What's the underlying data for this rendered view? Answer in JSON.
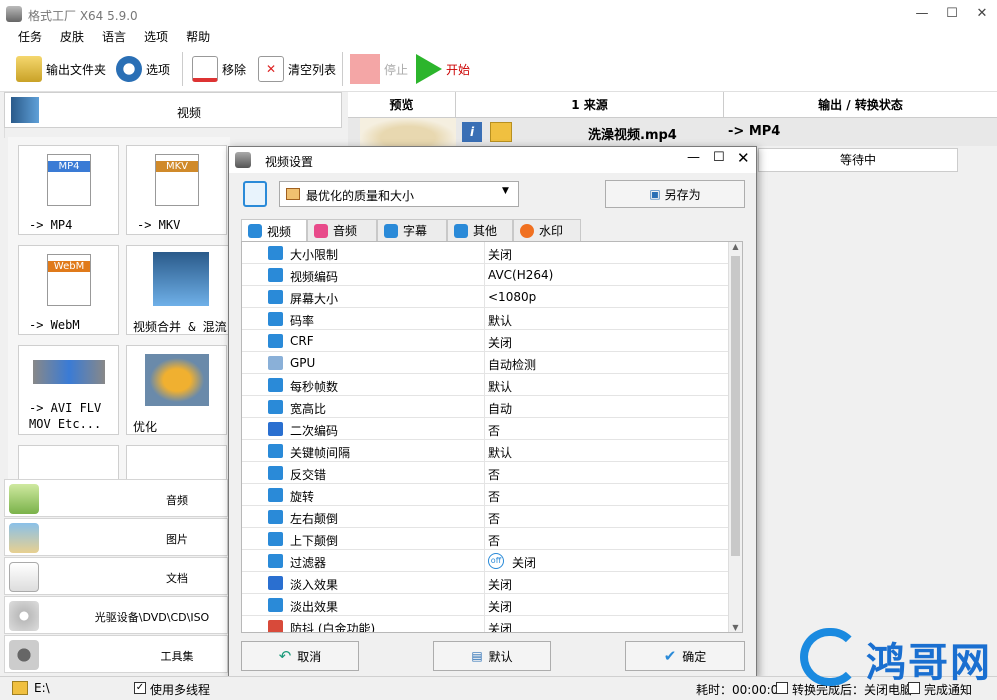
{
  "app": {
    "title": "格式工厂 X64 5.9.0"
  },
  "menu": [
    "任务",
    "皮肤",
    "语言",
    "选项",
    "帮助"
  ],
  "toolbar": {
    "output_folder": "输出文件夹",
    "options": "选项",
    "remove": "移除",
    "clear_list": "清空列表",
    "stop": "停止",
    "start": "开始"
  },
  "left": {
    "video_header": "视频",
    "tiles": [
      {
        "label": "-> MP4",
        "badge": "MP4"
      },
      {
        "label": "-> MKV",
        "badge": "MKV"
      },
      {
        "label": "-> WebM",
        "badge": "WebM"
      },
      {
        "label": "视频合并 & 混流"
      },
      {
        "label": "-> AVI FLV\nMOV Etc..."
      },
      {
        "label": "优化"
      }
    ],
    "categories": [
      "音频",
      "图片",
      "文档",
      "光驱设备\\DVD\\CD\\ISO",
      "工具集"
    ]
  },
  "grid": {
    "headers": [
      "预览",
      "1 来源",
      "输出 / 转换状态"
    ],
    "file_name": "洗澡视频.mp4",
    "output": "-> MP4",
    "status": "等待中"
  },
  "dialog": {
    "title": "视频设置",
    "preset": "最优化的质量和大小",
    "save_as": "另存为",
    "tabs": [
      "视频",
      "音频",
      "字幕",
      "其他",
      "水印"
    ],
    "params": [
      {
        "name": "大小限制",
        "value": "关闭",
        "icon": "size-limit"
      },
      {
        "name": "视频编码",
        "value": "AVC(H264)",
        "icon": "codec"
      },
      {
        "name": "屏幕大小",
        "value": "<1080p",
        "icon": "screen"
      },
      {
        "name": "码率",
        "value": "默认",
        "icon": "bitrate"
      },
      {
        "name": "CRF",
        "value": "关闭",
        "icon": "crf"
      },
      {
        "name": "GPU",
        "value": "自动检测",
        "icon": "gpu"
      },
      {
        "name": "每秒帧数",
        "value": "默认",
        "icon": "fps"
      },
      {
        "name": "宽高比",
        "value": "自动",
        "icon": "aspect"
      },
      {
        "name": "二次编码",
        "value": "否",
        "icon": "two-pass"
      },
      {
        "name": "关键帧间隔",
        "value": "默认",
        "icon": "keyframe"
      },
      {
        "name": "反交错",
        "value": "否",
        "icon": "deinterlace"
      },
      {
        "name": "旋转",
        "value": "否",
        "icon": "rotate"
      },
      {
        "name": "左右颠倒",
        "value": "否",
        "icon": "flip-h"
      },
      {
        "name": "上下颠倒",
        "value": "否",
        "icon": "flip-v"
      },
      {
        "name": "过滤器",
        "value": "关闭",
        "icon": "filter",
        "badge": "off"
      },
      {
        "name": "淡入效果",
        "value": "关闭",
        "icon": "fade-in"
      },
      {
        "name": "淡出效果",
        "value": "关闭",
        "icon": "fade-out"
      },
      {
        "name": "防抖 (白金功能)",
        "value": "关闭",
        "icon": "stabilize"
      }
    ],
    "cancel": "取消",
    "default": "默认",
    "ok": "确定"
  },
  "status": {
    "drive": "E:\\",
    "multithread": "使用多线程",
    "elapsed": "耗时：00:00:00",
    "after": "转换完成后：关闭电脑",
    "notify": "完成通知"
  },
  "watermark": {
    "text": "鸿哥网"
  }
}
